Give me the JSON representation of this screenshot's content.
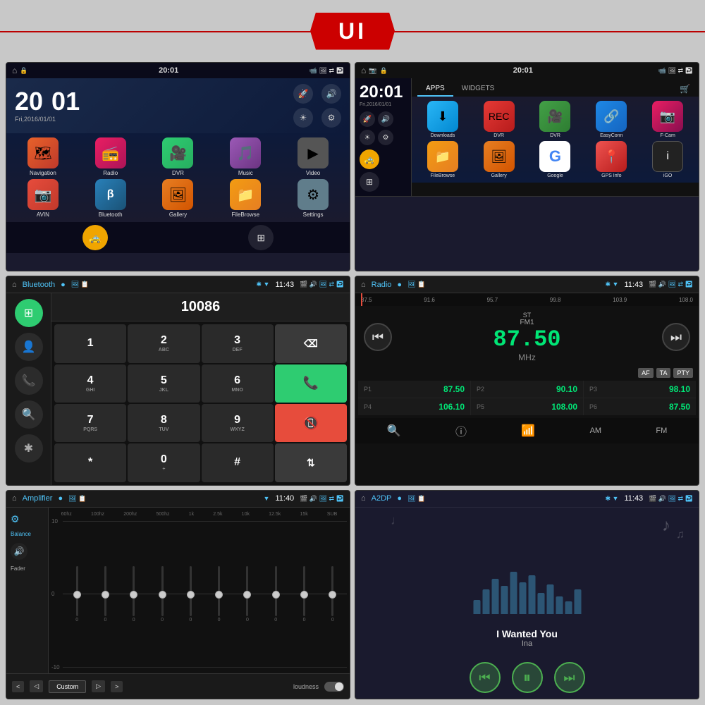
{
  "banner": {
    "title": "UI"
  },
  "screen1": {
    "title": "Home",
    "time": "20:01",
    "date": "Fri,2016/01/01",
    "clock_h": "20",
    "clock_m": "01",
    "apps": [
      {
        "label": "Navigation",
        "icon": "🗺"
      },
      {
        "label": "Radio",
        "icon": "📻"
      },
      {
        "label": "DVR",
        "icon": "🎥"
      },
      {
        "label": "Music",
        "icon": "🎵"
      },
      {
        "label": "Video",
        "icon": "▶"
      },
      {
        "label": "AVIN",
        "icon": "📷"
      },
      {
        "label": "Bluetooth",
        "icon": "🔷"
      },
      {
        "label": "Gallery",
        "icon": "🖼"
      },
      {
        "label": "FileBrowse",
        "icon": "📁"
      },
      {
        "label": "Settings",
        "icon": "⚙"
      }
    ]
  },
  "screen2": {
    "title": "Apps/Widgets",
    "time": "20:01",
    "date": "Fri,2016/01/01",
    "tabs": [
      "APPS",
      "WIDGETS"
    ],
    "active_tab": 0,
    "apps": [
      {
        "label": "Downloads",
        "icon": "⬇"
      },
      {
        "label": "DVR",
        "icon": "🎬"
      },
      {
        "label": "DVR",
        "icon": "🎥"
      },
      {
        "label": "EasyConn",
        "icon": "🔗"
      },
      {
        "label": "F-Cam",
        "icon": "📷"
      },
      {
        "label": "FileBrowse",
        "icon": "📁"
      },
      {
        "label": "Gallery",
        "icon": "🖼"
      },
      {
        "label": "Google",
        "icon": "G"
      },
      {
        "label": "GPS Info",
        "icon": "📍"
      },
      {
        "label": "iGO",
        "icon": "i"
      }
    ]
  },
  "screen3": {
    "title": "Bluetooth",
    "time": "11:43",
    "number": "10086",
    "keys": [
      {
        "main": "1",
        "sub": ""
      },
      {
        "main": "2",
        "sub": "ABC"
      },
      {
        "main": "3",
        "sub": "DEF"
      },
      {
        "main": "⌫",
        "sub": ""
      },
      {
        "main": "4",
        "sub": "GHI"
      },
      {
        "main": "5",
        "sub": "JKL"
      },
      {
        "main": "6",
        "sub": "MNO"
      },
      {
        "main": "📞",
        "sub": ""
      },
      {
        "main": "7",
        "sub": "PQRS"
      },
      {
        "main": "8",
        "sub": "TUV"
      },
      {
        "main": "9",
        "sub": "WXYZ"
      },
      {
        "main": "📵",
        "sub": ""
      },
      {
        "main": "*",
        "sub": ""
      },
      {
        "main": "0",
        "sub": "+"
      },
      {
        "main": "#",
        "sub": ""
      },
      {
        "main": "⇅",
        "sub": ""
      }
    ]
  },
  "screen4": {
    "title": "Radio",
    "time": "11:43",
    "freq_labels": [
      "87.5",
      "91.6",
      "95.7",
      "99.8",
      "103.9",
      "108.0"
    ],
    "current_freq": "87.50",
    "unit": "MHz",
    "band": "FM1",
    "st": "ST",
    "flags": [
      "AF",
      "TA",
      "PTY"
    ],
    "presets": [
      {
        "label": "P1",
        "freq": "87.50"
      },
      {
        "label": "P2",
        "freq": "90.10"
      },
      {
        "label": "P3",
        "freq": "98.10"
      },
      {
        "label": "P4",
        "freq": "106.10"
      },
      {
        "label": "P5",
        "freq": "108.00"
      },
      {
        "label": "P6",
        "freq": "87.50"
      }
    ]
  },
  "screen5": {
    "title": "Amplifier",
    "time": "11:40",
    "bands": [
      "60hz",
      "100hz",
      "200hz",
      "500hz",
      "1k",
      "2.5k",
      "10k",
      "12.5k",
      "15k",
      "SUB"
    ],
    "levels": [
      0,
      0,
      0,
      0,
      0,
      0,
      0,
      0,
      0,
      0
    ],
    "grid_labels": [
      "10",
      "0",
      "-10"
    ],
    "balance_label": "Balance",
    "fader_label": "Fader",
    "preset_label": "Custom",
    "loudness_label": "loudness"
  },
  "screen6": {
    "title": "A2DP",
    "time": "11:43",
    "song": "I Wanted You",
    "artist": "Ina"
  }
}
